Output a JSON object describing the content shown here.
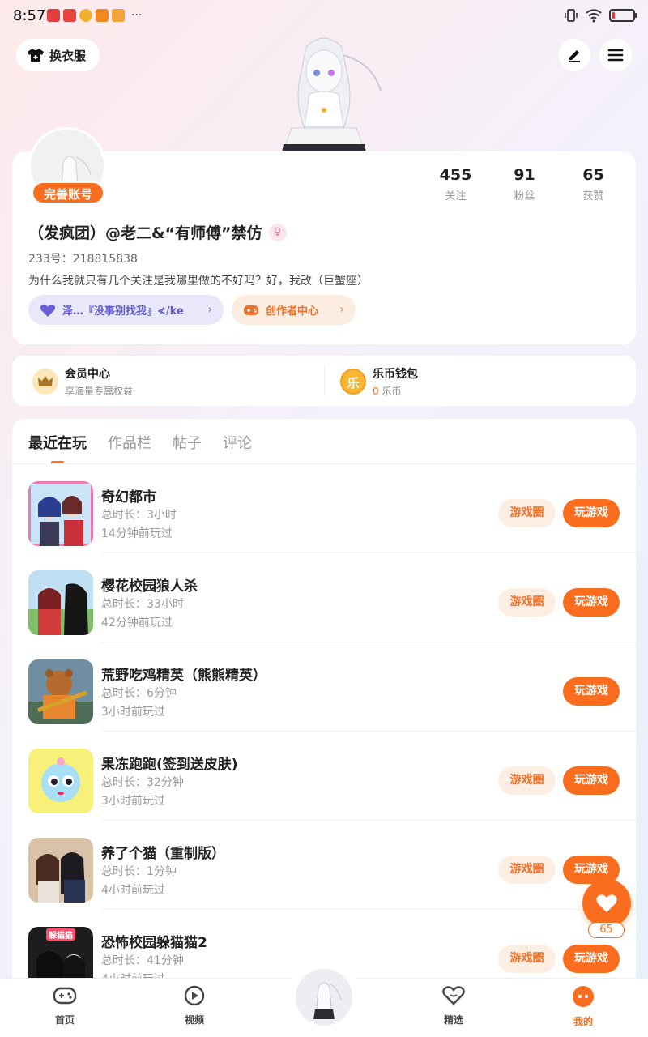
{
  "status_bar": {
    "time": "8:57",
    "dots": "···",
    "battery_level": 0.12
  },
  "header": {
    "dress_label": "换衣服"
  },
  "profile": {
    "complete_label": "完善账号",
    "stats": [
      {
        "value": "455",
        "label": "关注"
      },
      {
        "value": "91",
        "label": "粉丝"
      },
      {
        "value": "65",
        "label": "获赞"
      }
    ],
    "nickname": "（发疯团）@老二&“有师傅”禁仿",
    "uid": "233号：218815838",
    "bio": "为什么我就只有几个关注是我哪里做的不好吗？好，我改（巨蟹座）",
    "club_chip": "泽…『没事别找我』≮/ke",
    "creator_chip": "创作者中心"
  },
  "member": {
    "vip_title": "会员中心",
    "vip_sub": "享海量专属权益",
    "wallet_title": "乐币钱包",
    "wallet_amount": "0",
    "wallet_unit": "乐币",
    "wallet_icon_char": "乐"
  },
  "tabs": [
    "最近在玩",
    "作品栏",
    "帖子",
    "评论"
  ],
  "games": [
    {
      "title": "奇幻都市",
      "duration": "总时长：3小时",
      "last": "14分钟前玩过",
      "circle": "游戏圈",
      "play": "玩游戏"
    },
    {
      "title": "樱花校园狼人杀",
      "duration": "总时长：33小时",
      "last": "42分钟前玩过",
      "circle": "游戏圈",
      "play": "玩游戏"
    },
    {
      "title": "荒野吃鸡精英（熊熊精英）",
      "duration": "总时长：6分钟",
      "last": "3小时前玩过",
      "circle": "",
      "play": "玩游戏"
    },
    {
      "title": "果冻跑跑(签到送皮肤)",
      "duration": "总时长：32分钟",
      "last": "3小时前玩过",
      "circle": "游戏圈",
      "play": "玩游戏"
    },
    {
      "title": "养了个猫（重制版）",
      "duration": "总时长：1分钟",
      "last": "4小时前玩过",
      "circle": "游戏圈",
      "play": "玩游戏"
    },
    {
      "title": "恐怖校园躲猫猫2",
      "duration": "总时长：41分钟",
      "last": "4小时前玩过",
      "circle": "游戏圈",
      "play": "玩游戏",
      "thumb_text": "躲猫猫"
    }
  ],
  "fab": {
    "count": "65"
  },
  "nav": [
    {
      "label": "首页"
    },
    {
      "label": "视频"
    },
    {
      "label": "精选"
    },
    {
      "label": "我的"
    }
  ],
  "colors": {
    "accent": "#fa6d1e",
    "accent_light": "#fdeee4",
    "club": "#6258c9"
  }
}
